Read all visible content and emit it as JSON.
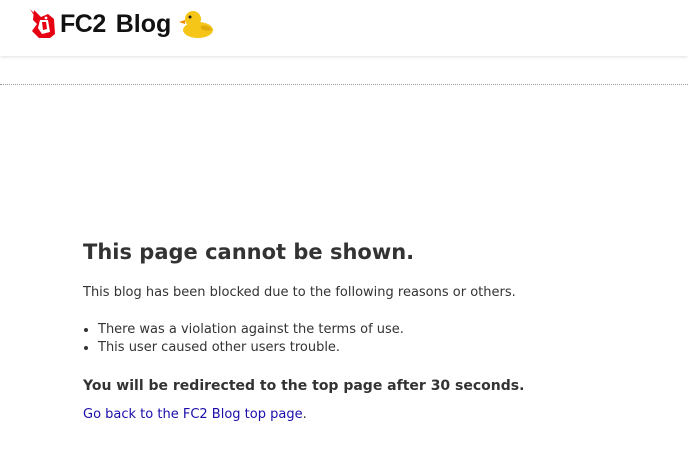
{
  "header": {
    "logo_fc2": "FC2",
    "logo_blog": "Blog",
    "logo_icon": "fc2-unicorn-icon",
    "mascot_icon": "rubber-duck-icon",
    "brand_color": "#e60012"
  },
  "main": {
    "title": "This page cannot be shown.",
    "reason_intro": "This blog has been blocked due to the following reasons or others.",
    "reasons": [
      "There was a violation against the terms of use.",
      "This user caused other users trouble."
    ],
    "redirect_notice": "You will be redirected to the top page after 30 seconds.",
    "back_link_text": "Go back to the FC2 Blog top page",
    "back_link_suffix": "."
  }
}
